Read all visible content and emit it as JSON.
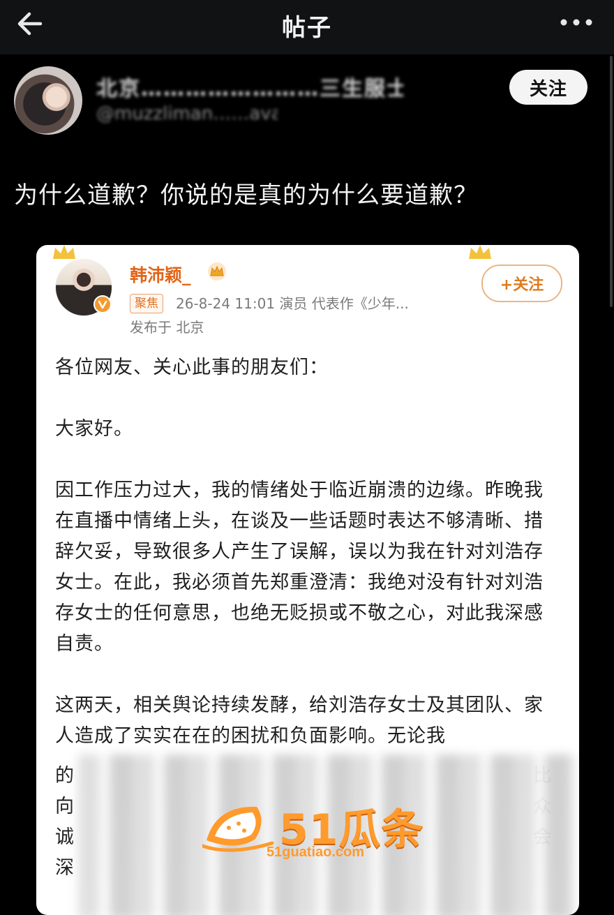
{
  "header": {
    "title": "帖子"
  },
  "poster": {
    "name": "北京……………………三生服士",
    "handle": "@muzzliman……ava",
    "follow_label": "关注"
  },
  "post": {
    "text": "为什么道歉？你说的是真的为什么要道歉？"
  },
  "embedded_post": {
    "author": "韩沛颖_",
    "tag": "聚焦",
    "meta": "26-8-24 11:01  演员 代表作《少年...",
    "location": "发布于 北京",
    "follow_label": "+关注",
    "paragraphs": [
      "各位网友、关心此事的朋友们：",
      "大家好。",
      "因工作压力过大，我的情绪处于临近崩溃的边缘。昨晚我在直播中情绪上头，在谈及一些话题时表达不够清晰、措辞欠妥，导致很多人产生了误解，误以为我在针对刘浩存女士。在此，我必须首先郑重澄清：我绝对没有针对刘浩存女士的任何意思，也绝无贬损或不敬之心，对此我深感自责。",
      "这两天，相关舆论持续发酵，给刘浩存女士及其团队、家人造成了实实在在的困扰和负面影响。无论我"
    ],
    "partial_lines": [
      "的",
      "向",
      "诚",
      "深"
    ],
    "partial_right": [
      "比",
      "众",
      "会"
    ]
  },
  "watermark": {
    "main": "51瓜条",
    "sub": "51guatiao.com"
  },
  "colors": {
    "accent_orange": "#e0651a",
    "page_bg": "#000000"
  }
}
